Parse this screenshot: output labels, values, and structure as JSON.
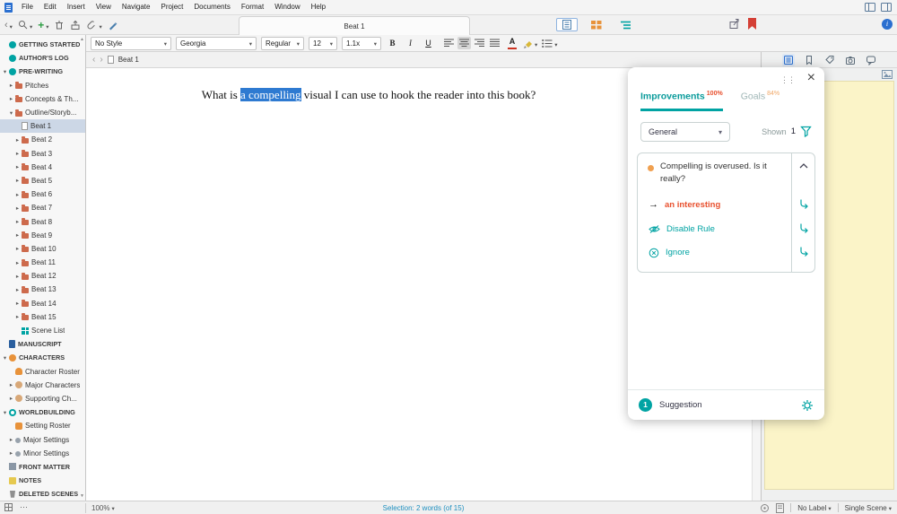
{
  "colors": {
    "accent_teal": "#00a3a3",
    "alert_orange": "#e8502e",
    "selection_blue": "#2e7ad1",
    "binder_selected": "#ccd7e6",
    "synopsis_yellow": "#fbf4c8",
    "corkboard_orange": "#e8923a",
    "bookmark_red": "#d43f35"
  },
  "icons": {
    "close": "×",
    "back": "‹",
    "forward": "›",
    "drag_dots": "⋮⋮",
    "ellipsis": "⋯",
    "arrow_right": "→",
    "plus": "+"
  },
  "menubar": {
    "items": [
      "File",
      "Edit",
      "Insert",
      "View",
      "Navigate",
      "Project",
      "Documents",
      "Format",
      "Window",
      "Help"
    ]
  },
  "toolbar": {
    "tab_title": "Beat 1"
  },
  "formatbar": {
    "style": "No Style",
    "font": "Georgia",
    "variant": "Regular",
    "size": "12",
    "line_spacing": "1.1x",
    "bold": "B",
    "italic": "I",
    "underline": "U",
    "color_letter": "A"
  },
  "binder": {
    "items": [
      {
        "label": "GETTING STARTED",
        "icon": "rocket",
        "level": 0,
        "caps": true,
        "arrow": ""
      },
      {
        "label": "AUTHOR'S LOG",
        "icon": "log",
        "level": 0,
        "caps": true,
        "arrow": ""
      },
      {
        "label": "PRE-WRITING",
        "icon": "prewriting",
        "level": 0,
        "caps": true,
        "arrow": "down"
      },
      {
        "label": "Pitches",
        "icon": "folder",
        "level": 1,
        "arrow": "right"
      },
      {
        "label": "Concepts & Th...",
        "icon": "folder",
        "level": 1,
        "arrow": "right"
      },
      {
        "label": "Outline/Storyb...",
        "icon": "folder",
        "level": 1,
        "arrow": "down"
      },
      {
        "label": "Beat 1",
        "icon": "doc",
        "level": 2,
        "selected": true,
        "arrow": ""
      },
      {
        "label": "Beat 2",
        "icon": "folder",
        "level": 2,
        "arrow": "right"
      },
      {
        "label": "Beat 3",
        "icon": "folder",
        "level": 2,
        "arrow": "right"
      },
      {
        "label": "Beat 4",
        "icon": "folder",
        "level": 2,
        "arrow": "right"
      },
      {
        "label": "Beat 5",
        "icon": "folder",
        "level": 2,
        "arrow": "right"
      },
      {
        "label": "Beat 6",
        "icon": "folder",
        "level": 2,
        "arrow": "right"
      },
      {
        "label": "Beat 7",
        "icon": "folder",
        "level": 2,
        "arrow": "right"
      },
      {
        "label": "Beat 8",
        "icon": "folder",
        "level": 2,
        "arrow": "right"
      },
      {
        "label": "Beat 9",
        "icon": "folder",
        "level": 2,
        "arrow": "right"
      },
      {
        "label": "Beat 10",
        "icon": "folder",
        "level": 2,
        "arrow": "right"
      },
      {
        "label": "Beat 11",
        "icon": "folder",
        "level": 2,
        "arrow": "right"
      },
      {
        "label": "Beat 12",
        "icon": "folder",
        "level": 2,
        "arrow": "right"
      },
      {
        "label": "Beat 13",
        "icon": "folder",
        "level": 2,
        "arrow": "right"
      },
      {
        "label": "Beat 14",
        "icon": "folder",
        "level": 2,
        "arrow": "right"
      },
      {
        "label": "Beat 15",
        "icon": "folder",
        "level": 2,
        "arrow": "right"
      },
      {
        "label": "Scene List",
        "icon": "grid",
        "level": 2,
        "arrow": ""
      },
      {
        "label": "MANUSCRIPT",
        "icon": "book",
        "level": 0,
        "caps": true,
        "arrow": ""
      },
      {
        "label": "CHARACTERS",
        "icon": "people",
        "level": 0,
        "caps": true,
        "arrow": "down"
      },
      {
        "label": "Character Roster",
        "icon": "person-orange",
        "level": 1,
        "arrow": ""
      },
      {
        "label": "Major Characters",
        "icon": "person",
        "level": 1,
        "arrow": "right"
      },
      {
        "label": "Supporting Ch...",
        "icon": "person",
        "level": 1,
        "arrow": "right"
      },
      {
        "label": "WORLDBUILDING",
        "icon": "globe",
        "level": 0,
        "caps": true,
        "arrow": "down"
      },
      {
        "label": "Setting Roster",
        "icon": "setting-orange",
        "level": 1,
        "arrow": ""
      },
      {
        "label": "Major Settings",
        "icon": "pin",
        "level": 1,
        "arrow": "right"
      },
      {
        "label": "Minor Settings",
        "icon": "pin",
        "level": 1,
        "arrow": "right"
      },
      {
        "label": "FRONT MATTER",
        "icon": "frontmatter",
        "level": 0,
        "caps": true,
        "arrow": ""
      },
      {
        "label": "NOTES",
        "icon": "note",
        "level": 0,
        "caps": true,
        "arrow": ""
      },
      {
        "label": "DELETED SCENES",
        "icon": "trash",
        "level": 0,
        "caps": true,
        "arrow": ""
      }
    ]
  },
  "editor": {
    "title": "Beat 1",
    "text_before": "What is ",
    "text_selected": "a compelling",
    "text_after": " visual I can use to hook the reader into this book?"
  },
  "pwa": {
    "tab_improvements": "Improvements",
    "improvements_pct": "100%",
    "tab_goals": "Goals",
    "goals_pct": "84%",
    "filter_value": "General",
    "shown_label": "Shown",
    "shown_count": "1",
    "suggestion_title": "Compelling is overused. Is it really?",
    "replacement": "an interesting",
    "disable_rule": "Disable Rule",
    "ignore": "Ignore",
    "footer_count": "1",
    "footer_label": "Suggestion"
  },
  "statusbar": {
    "zoom": "100%",
    "selection_info": "Selection: 2 words (of 15)",
    "label_value": "No Label",
    "scene_value": "Single Scene"
  }
}
